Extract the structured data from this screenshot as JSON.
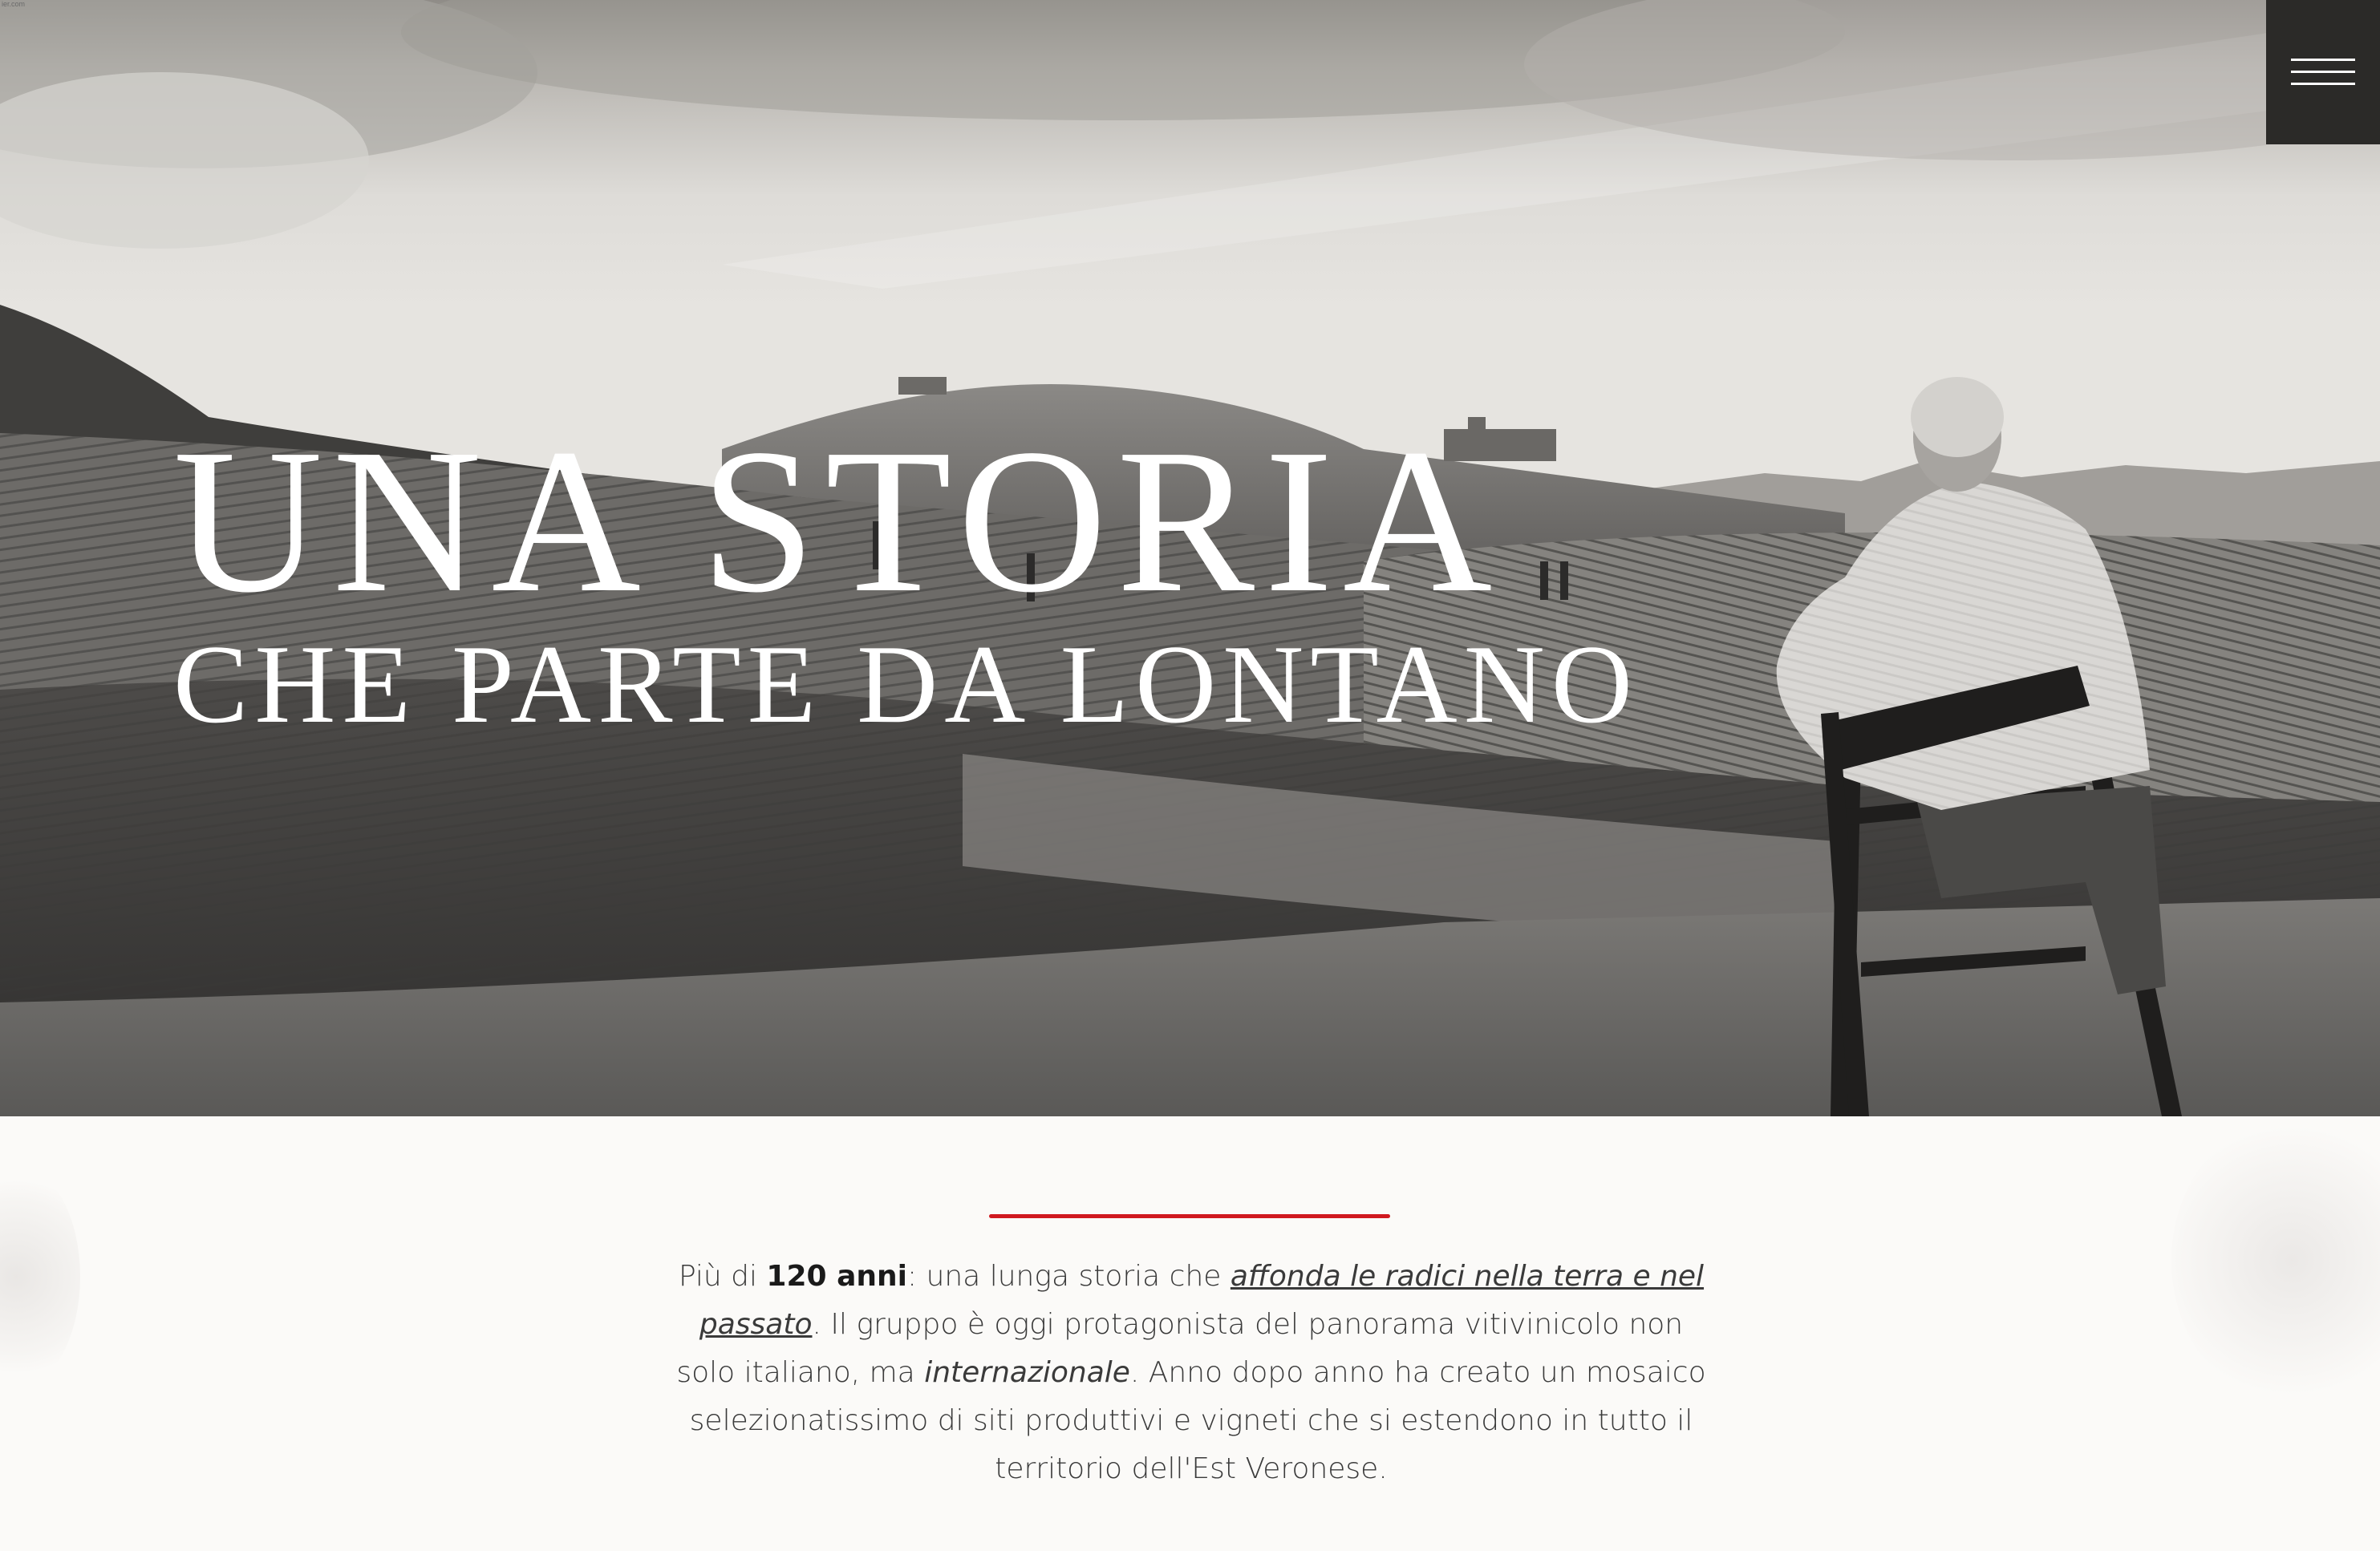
{
  "corner_label": "ier.com",
  "hero": {
    "title_line1": "UNA STORIA",
    "title_line2": "CHE PARTE DA LONTANO",
    "image_subject": "man seated on chair overlooking vineyard hills"
  },
  "menu": {
    "icon": "hamburger-icon"
  },
  "intro": {
    "part1": "Più di ",
    "bold": "120 anni",
    "part2": ": una lunga storia che ",
    "link": "affonda le radici nella terra e nel passato",
    "part3": ".  Il gruppo è oggi protagonista del panorama vitivinicolo non solo italiano, ma ",
    "italic": "internazionale",
    "part4": ". Anno dopo anno ha creato un mosaico selezionatissimo di siti produttivi e vigneti che si estendono in tutto il territorio dell'Est Veronese."
  },
  "colors": {
    "accent_red": "#d01920",
    "menu_bg": "#2b2a28",
    "page_bg": "#fbfaf8"
  }
}
